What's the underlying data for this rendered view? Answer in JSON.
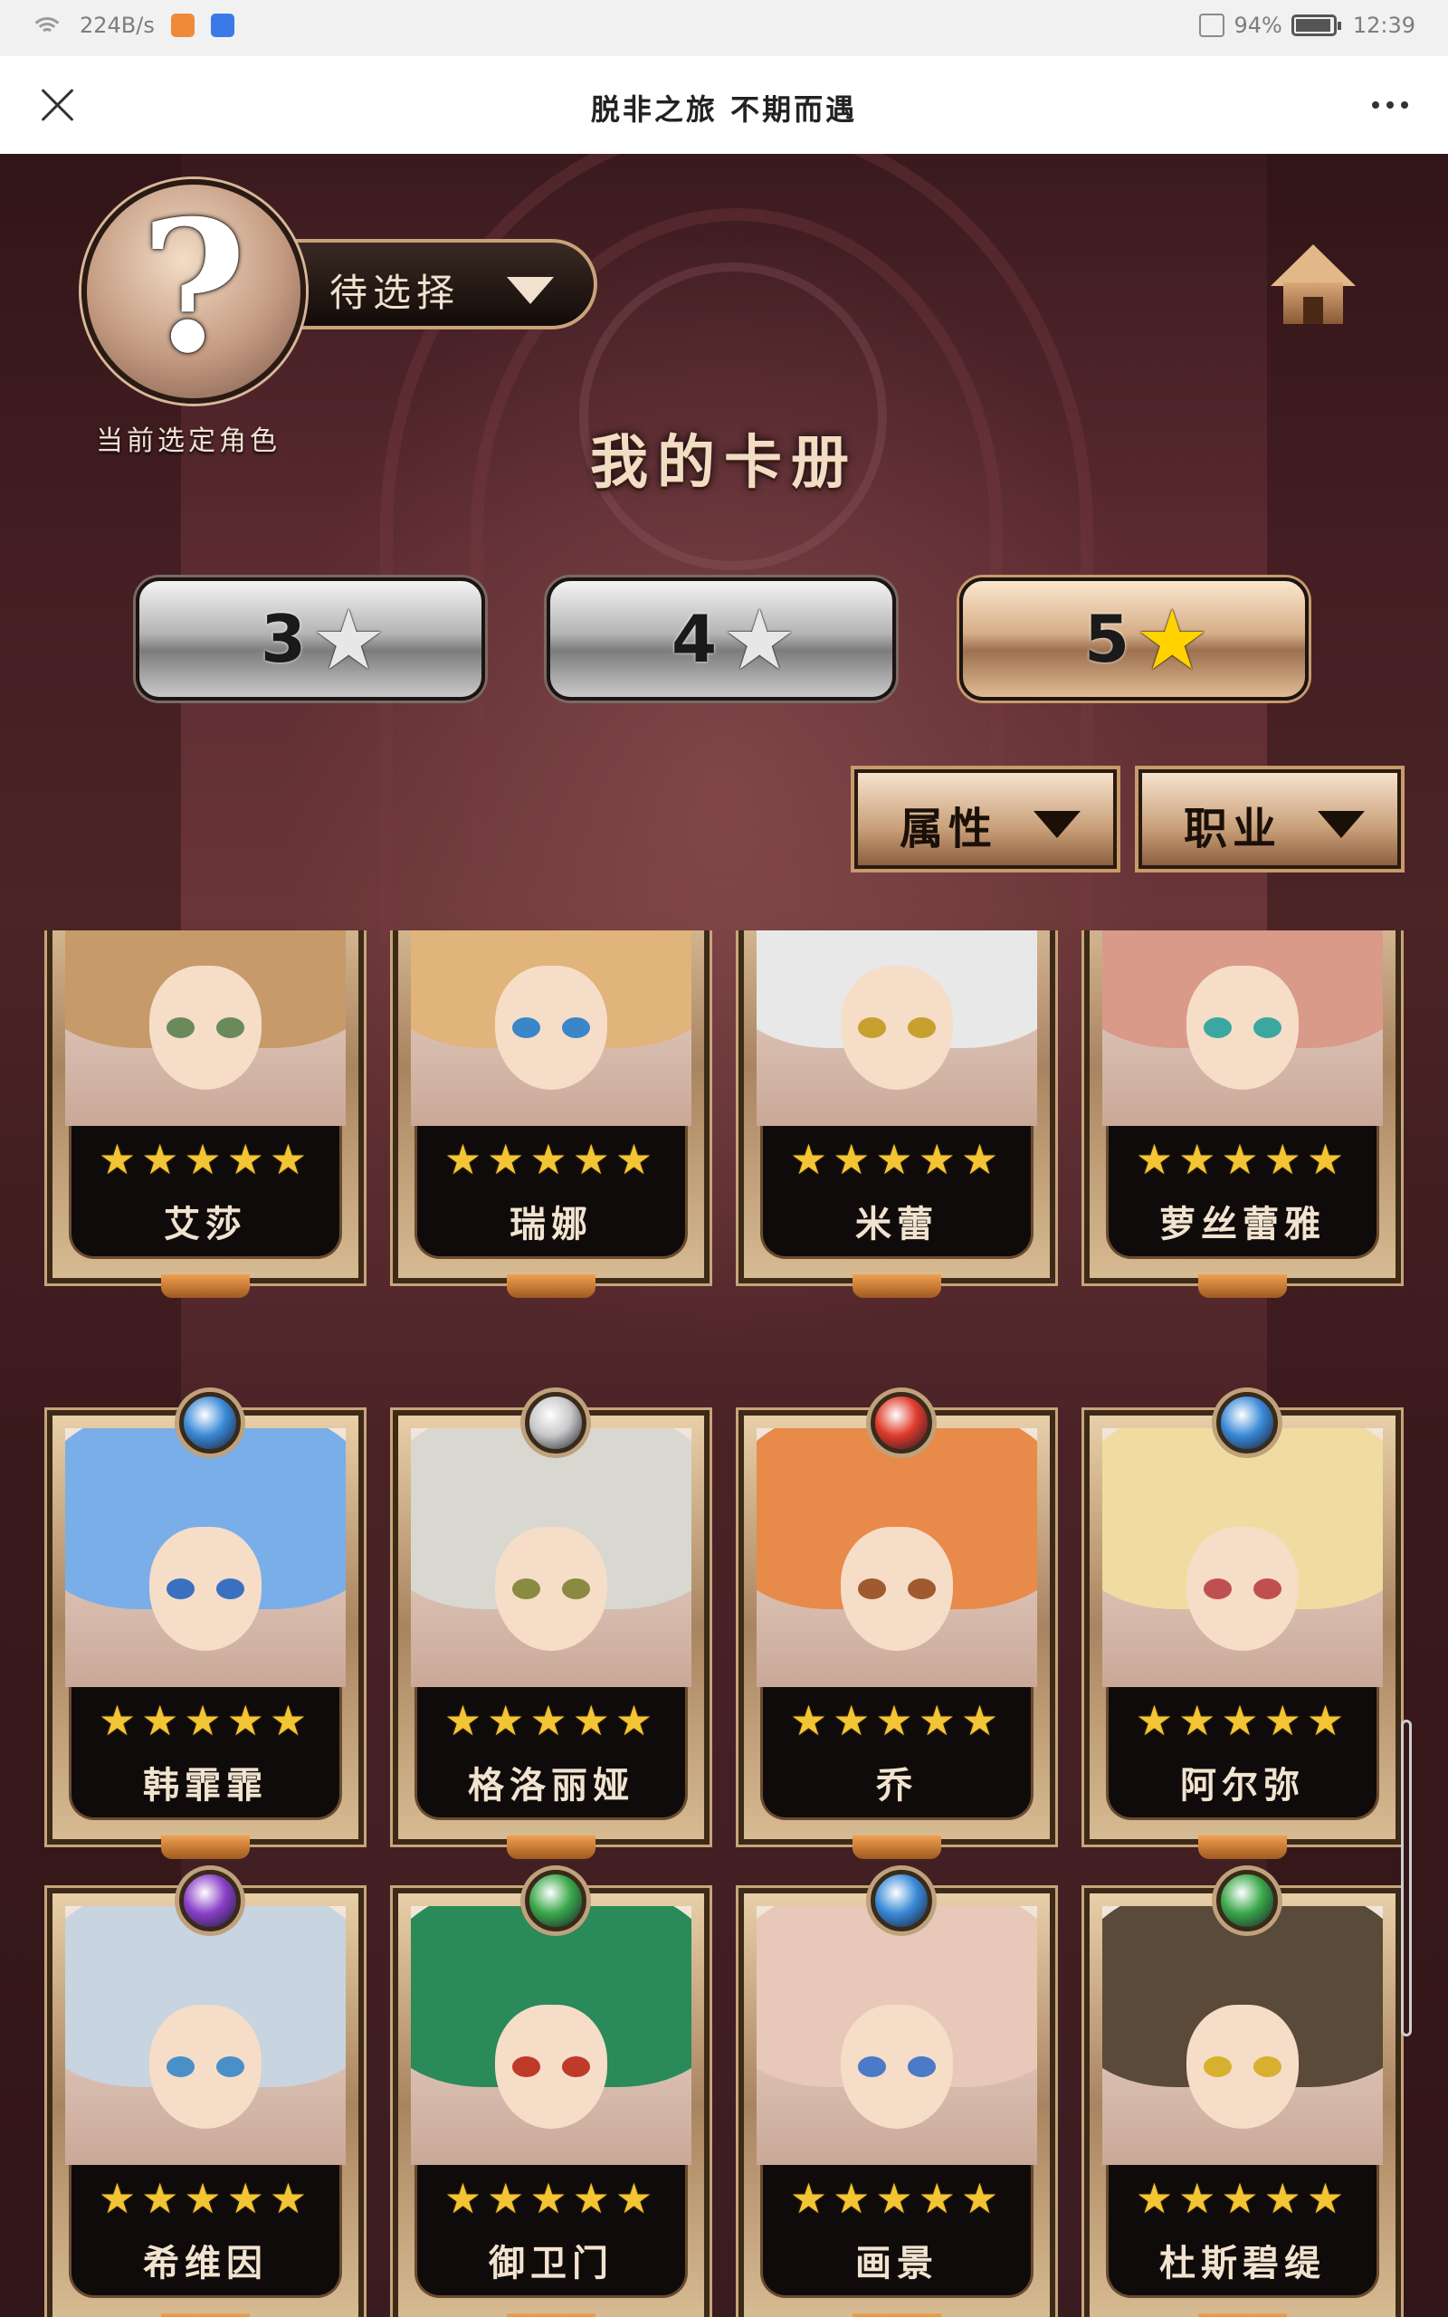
{
  "status_bar": {
    "network_speed": "224B/s",
    "battery_percent": "94%",
    "battery_level": 0.94,
    "time": "12:39"
  },
  "title_bar": {
    "title": "脱非之旅 不期而遇"
  },
  "header": {
    "avatar_glyph": "?",
    "avatar_caption": "当前选定角色",
    "role_select_value": "待选择"
  },
  "album_title": "我的卡册",
  "star_tabs": [
    {
      "label": "3",
      "star": "★",
      "active": false
    },
    {
      "label": "4",
      "star": "★",
      "active": false
    },
    {
      "label": "5",
      "star": "★",
      "active": true
    }
  ],
  "filters": {
    "attribute": "属性",
    "profession": "职业"
  },
  "card_rows": [
    [
      {
        "name": "艾莎",
        "stars": "★★★★★",
        "hair": "#c79a6a",
        "eye": "#6a8a5a",
        "crest": null
      },
      {
        "name": "瑞娜",
        "stars": "★★★★★",
        "hair": "#e0b47a",
        "eye": "#3a86c8",
        "crest": null
      },
      {
        "name": "米蕾",
        "stars": "★★★★★",
        "hair": "#e8e8e8",
        "eye": "#c8a030",
        "crest": null
      },
      {
        "name": "萝丝蕾雅",
        "stars": "★★★★★",
        "hair": "#d99a8a",
        "eye": "#3aa8a0",
        "crest": null
      }
    ],
    [
      {
        "name": "韩霏霏",
        "stars": "★★★★★",
        "hair": "#7aaee8",
        "eye": "#3a70c0",
        "crest": "#3a8ad8"
      },
      {
        "name": "格洛丽娅",
        "stars": "★★★★★",
        "hair": "#d8d8d0",
        "eye": "#8a8a40",
        "crest": "#c8c8c8"
      },
      {
        "name": "乔",
        "stars": "★★★★★",
        "hair": "#e88a4a",
        "eye": "#a05a30",
        "crest": "#e03a2a"
      },
      {
        "name": "阿尔弥",
        "stars": "★★★★★",
        "hair": "#f0dca0",
        "eye": "#c05050",
        "crest": "#3a8ad8"
      }
    ],
    [
      {
        "name": "希维因",
        "stars": "★★★★★",
        "hair": "#c8d4e0",
        "eye": "#4a90c8",
        "crest": "#8a40c8"
      },
      {
        "name": "御卫门",
        "stars": "★★★★★",
        "hair": "#2a8a5a",
        "eye": "#c03a2a",
        "crest": "#3aa84a"
      },
      {
        "name": "画景",
        "stars": "★★★★★",
        "hair": "#e8c8b8",
        "eye": "#4a7ac8",
        "crest": "#3a8ad8"
      },
      {
        "name": "杜斯碧缇",
        "stars": "★★★★★",
        "hair": "#5a4a3a",
        "eye": "#d8b030",
        "crest": "#3aa84a"
      }
    ]
  ],
  "icons": {
    "close": "close-icon",
    "more": "more-icon",
    "home": "home-icon",
    "dropdown": "chevron-down-icon",
    "star": "star-icon"
  }
}
